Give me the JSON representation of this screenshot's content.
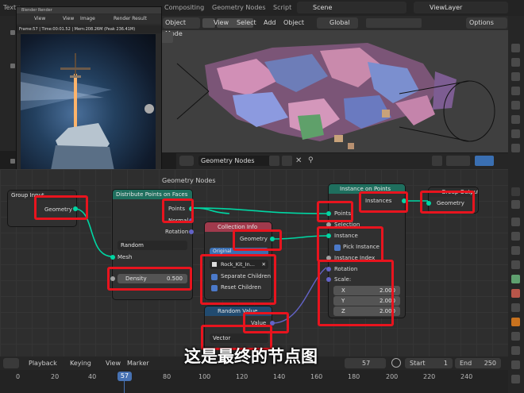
{
  "topbar": {
    "tabs": [
      "Textu",
      "Compositing",
      "Geometry Nodes",
      "Script"
    ],
    "scene": "Scene",
    "view_layer": "ViewLayer"
  },
  "render_window": {
    "title": "Blender Render",
    "menu": [
      "View",
      "View",
      "Image"
    ],
    "slot": "Render Result",
    "info": "Frame:57 | Time:00:01.52 | Mem:208.26M (Peak 236.41M)"
  },
  "viewport": {
    "mode": "Object Mode",
    "menu": [
      "View",
      "Select",
      "Add",
      "Object"
    ],
    "transform": "Global",
    "options": "Options"
  },
  "node_editor": {
    "tree_name": "Geometry Nodes",
    "breadcrumb": "Geometry Nodes"
  },
  "nodes": {
    "group_input": {
      "title": "Group Input",
      "out_geometry": "Geometry"
    },
    "distribute": {
      "title": "Distribute Points on Faces",
      "out_points": "Points",
      "out_normal": "Normal",
      "out_rotation": "Rotation",
      "mode": "Random",
      "in_mesh": "Mesh",
      "density_label": "Density",
      "density_value": "0.500"
    },
    "collection_info": {
      "title": "Collection Info",
      "out_geometry": "Geometry",
      "transform_space": "Original",
      "collection": "Rock_Kit_In...",
      "separate_children": "Separate Children",
      "reset_children": "Reset Children"
    },
    "random_value": {
      "title": "Random Value",
      "out_value": "Value",
      "data_type": "Vector"
    },
    "instance_on_points": {
      "title": "Instance on Points",
      "out_instances": "Instances",
      "in_points": "Points",
      "in_selection": "Selection",
      "in_instance": "Instance",
      "pick_instance": "Pick Instance",
      "instance_index": "Instance Index",
      "in_rotation": "Rotation",
      "in_scale": "Scale:",
      "scale": [
        {
          "axis": "X",
          "value": "2.000"
        },
        {
          "axis": "Y",
          "value": "2.000"
        },
        {
          "axis": "Z",
          "value": "2.000"
        }
      ]
    },
    "group_output": {
      "title": "Group Output",
      "in_geometry": "Geometry"
    }
  },
  "timeline": {
    "menu": [
      "Playback",
      "Keying",
      "View",
      "Marker"
    ],
    "current_frame": "57",
    "start_label": "Start",
    "start_value": "1",
    "end_label": "End",
    "end_value": "250",
    "ruler": [
      "0",
      "20",
      "40",
      "57",
      "80",
      "100",
      "120",
      "140",
      "160",
      "180",
      "200",
      "220",
      "240"
    ]
  },
  "caption": "这是最终的节点图",
  "colors": {
    "geometry_socket": "#00d6a3",
    "vector_socket": "#6363c7",
    "highlight": "#e8141e",
    "instance_node": "#a03a4c",
    "geometry_node": "#1f6f5e"
  }
}
